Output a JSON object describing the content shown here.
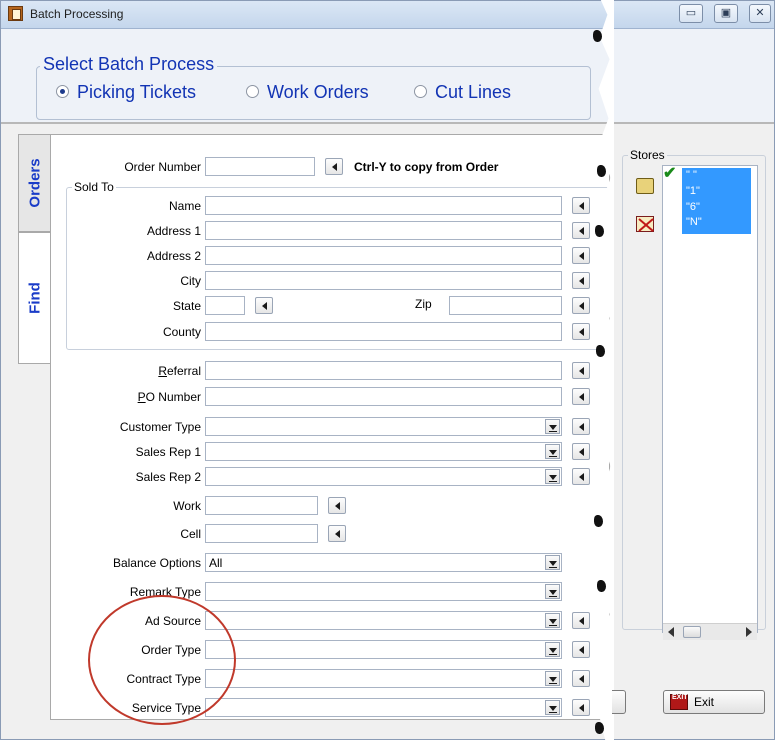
{
  "window": {
    "title": "Batch Processing",
    "min": "▭",
    "max": "▣",
    "close": "✕"
  },
  "batch": {
    "legend": "Select Batch Process",
    "options": [
      {
        "label": "Picking Tickets",
        "selected": true
      },
      {
        "label": "Work Orders",
        "selected": false
      },
      {
        "label": "Cut Lines",
        "selected": false
      }
    ]
  },
  "tabs": {
    "orders": "Orders",
    "find": "Find"
  },
  "form": {
    "order_number": {
      "label": "Order Number",
      "value": ""
    },
    "copy_hint": "Ctrl-Y to copy from Order",
    "sold_to": {
      "legend": "Sold To",
      "name": "Name",
      "address1": "Address 1",
      "address2": "Address 2",
      "city": "City",
      "state": "State",
      "zip": "Zip",
      "county": "County"
    },
    "referral": "Referral",
    "po_number": "PO Number",
    "customer_type": "Customer Type",
    "sales_rep1": "Sales Rep 1",
    "sales_rep2": "Sales Rep 2",
    "work": "Work",
    "cell": "Cell",
    "balance_options": {
      "label": "Balance Options",
      "value": "All"
    },
    "remark_type": "Remark Type",
    "ad_source": "Ad Source",
    "order_type": "Order Type",
    "contract_type": "Contract Type",
    "service_type": "Service Type"
  },
  "stores": {
    "legend": "Stores",
    "items": [
      "\" \"",
      "\"1\"",
      "\"6\"",
      "\"N\""
    ]
  },
  "buttons": {
    "exit": "Exit",
    "exit_icon_text": "EXIT"
  },
  "colors": {
    "accent_blue": "#1234b4",
    "selection": "#3399ff",
    "annotation": "#c0392b"
  }
}
